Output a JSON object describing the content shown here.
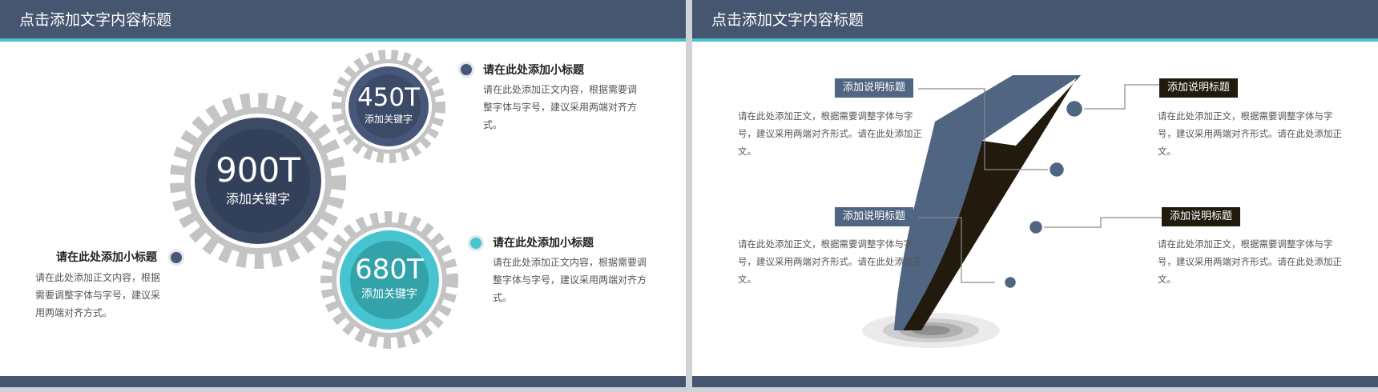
{
  "left_slide": {
    "title": "点击添加文字内容标题",
    "gear_big": {
      "value": "900T",
      "keyword": "添加关键字"
    },
    "gear_top": {
      "value": "450T",
      "keyword": "添加关键字"
    },
    "gear_bottom": {
      "value": "680T",
      "keyword": "添加关键字"
    },
    "item_top": {
      "heading": "请在此处添加小标题",
      "body": "请在此处添加正文内容，根据需要调整字体与字号，建议采用两端对齐方式。"
    },
    "item_bottom": {
      "heading": "请在此处添加小标题",
      "body": "请在此处添加正文内容，根据需要调整字体与字号，建议采用两端对齐方式。"
    },
    "item_left": {
      "heading": "请在此处添加小标题",
      "body": "请在此处添加正文内容，根据需要调整字体与字号，建议采用两端对齐方式。"
    }
  },
  "right_slide": {
    "title": "点击添加文字内容标题",
    "tags": {
      "top_left": "添加说明标题",
      "bottom_left": "添加说明标题",
      "top_right": "添加说明标题",
      "bottom_right": "添加说明标题"
    },
    "texts": {
      "top_left": "请在此处添加正文，根据需要调整字体与字号，建议采用两端对齐形式。请在此处添加正文。",
      "bottom_left": "请在此处添加正文，根据需要调整字体与字号，建议采用两端对齐形式。请在此处添加正文。",
      "top_right": "请在此处添加正文，根据需要调整字体与字号，建议采用两端对齐形式。请在此处添加正文。",
      "bottom_right": "请在此处添加正文，根据需要调整字体与字号，建议采用两端对齐形式。请在此处添加正文。"
    }
  },
  "colors": {
    "navy": "#465670",
    "teal": "#4bbfcb",
    "gear_gray": "#c4c4c4",
    "arrow_blue": "#4f6582",
    "arrow_dark": "#231a0e"
  }
}
